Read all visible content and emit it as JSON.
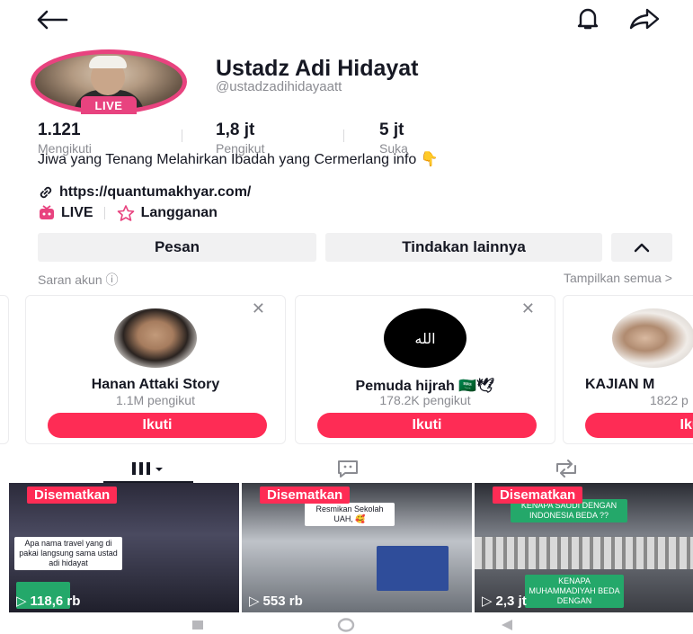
{
  "profile": {
    "name": "Ustadz Adi Hidayat",
    "handle": "@ustadzadihidayaatt",
    "live_badge": "LIVE",
    "stats": [
      {
        "value": "1.121",
        "label": "Mengikuti"
      },
      {
        "value": "1,8 jt",
        "label": "Pengikut"
      },
      {
        "value": "5 jt",
        "label": "Suka"
      }
    ],
    "bio": "Jiwa yang Tenang Melahirkan Ibadah yang Cermerlang info 👇",
    "link": "https://quantumakhyar.com/",
    "live_label": "LIVE",
    "subscription_label": "Langganan"
  },
  "actions": {
    "message": "Pesan",
    "more": "Tindakan lainnya",
    "collapse": "^"
  },
  "suggestions": {
    "title": "Saran akun ⓘ",
    "show_all": "Tampilkan semua >",
    "follow_label": "Ikuti",
    "cards": [
      {
        "name": "Hanan Attaki Story",
        "followers": "1.1M pengikut"
      },
      {
        "name": "Pemuda hijrah 🇸🇦🕊",
        "followers": "178.2K pengikut",
        "avatar_text": "الله"
      },
      {
        "name": "KAJIAN M",
        "followers": "1822 p"
      }
    ]
  },
  "videos": [
    {
      "pinned": "Disematkan",
      "views": "118,6 rb",
      "caption": "Apa nama travel yang di pakai langsung sama ustad adi hidayat"
    },
    {
      "pinned": "Disematkan",
      "views": "553 rb",
      "caption": "Resmikan Sekolah UAH, 🥰"
    },
    {
      "pinned": "Disematkan",
      "views": "2,3 jt",
      "caption": "KENAPA SAUDI DENGAN INDONESIA BEDA ??",
      "caption2": "KENAPA MUHAMMADIYAH BEDA DENGAN"
    }
  ],
  "colors": {
    "accent": "#fe2c55",
    "live_ring": "#e8437f",
    "muted_text": "#8a8b91",
    "button_bg": "#f1f1f2"
  }
}
